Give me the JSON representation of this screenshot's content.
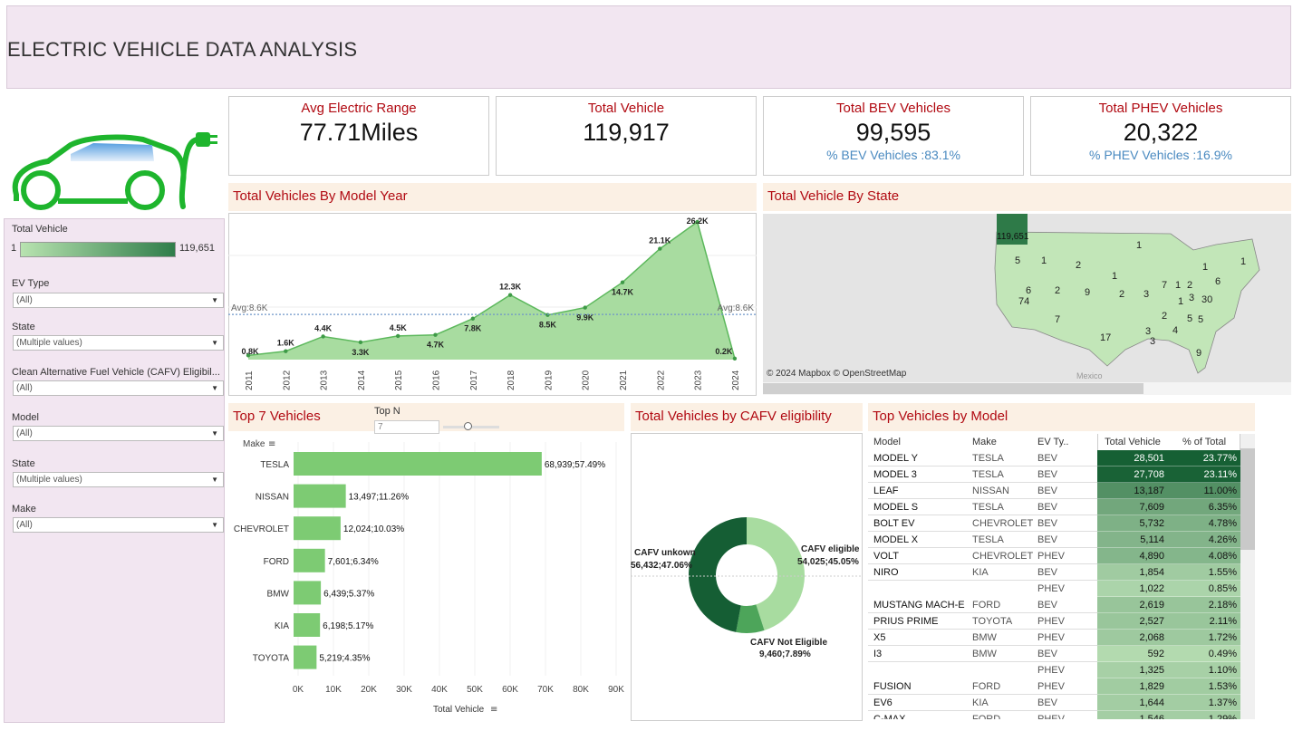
{
  "title": "ELECTRIC VEHICLE DATA ANALYSIS",
  "kpis": [
    {
      "label": "Avg Electric  Range",
      "value": "77.71Miles",
      "sub": ""
    },
    {
      "label": "Total Vehicle",
      "value": "119,917",
      "sub": ""
    },
    {
      "label": "Total BEV Vehicles",
      "value": "99,595",
      "sub": "% BEV Vehicles :83.1%"
    },
    {
      "label": "Total PHEV Vehicles",
      "value": "20,322",
      "sub": "% PHEV Vehicles :16.9%"
    }
  ],
  "filters": {
    "legend_title": "Total Vehicle",
    "legend_min": "1",
    "legend_max": "119,651",
    "items": [
      {
        "label": "EV Type",
        "value": "(All)"
      },
      {
        "label": "State",
        "value": "(Multiple values)"
      },
      {
        "label": "Clean Alternative Fuel Vehicle (CAFV) Eligibil...",
        "value": "(All)"
      },
      {
        "label": "Model",
        "value": "(All)"
      },
      {
        "label": "State",
        "value": "(Multiple values)"
      },
      {
        "label": "Make",
        "value": "(All)"
      }
    ]
  },
  "panels": {
    "model_year": "Total Vehicles By Model Year",
    "state": "Total Vehicle By State",
    "top7": "Top 7 Vehicles",
    "cafv": "Total Vehicles by CAFV eligibility",
    "top_model": "Top Vehicles by Model"
  },
  "top_n": {
    "label": "Top N",
    "value": "7"
  },
  "colors": {
    "accent_red": "#b10a12",
    "green_light": "#7dcb73",
    "green_dark": "#155e34",
    "panel_bg": "#fbf0e4",
    "filter_bg": "#f2e6f1"
  },
  "chart_data": [
    {
      "type": "area",
      "title": "Total Vehicles By Model Year",
      "x": [
        "2011",
        "2012",
        "2013",
        "2014",
        "2015",
        "2016",
        "2017",
        "2018",
        "2019",
        "2020",
        "2021",
        "2022",
        "2023",
        "2024"
      ],
      "values": [
        0.8,
        1.6,
        4.4,
        3.3,
        4.5,
        4.7,
        7.8,
        12.3,
        8.5,
        9.9,
        14.7,
        21.1,
        26.2,
        0.2
      ],
      "labels": [
        "0.8K",
        "1.6K",
        "4.4K",
        "3.3K",
        "4.5K",
        "4.7K",
        "7.8K",
        "12.3K",
        "8.5K",
        "9.9K",
        "14.7K",
        "21.1K",
        "26.2K",
        "0.2K"
      ],
      "average": 8.6,
      "average_label": "Avg:8.6K",
      "unit": "K"
    },
    {
      "type": "bar",
      "title": "Top 7 Vehicles",
      "ylabel": "Make",
      "xlabel": "Total Vehicle",
      "categories": [
        "TESLA",
        "NISSAN",
        "CHEVROLET",
        "FORD",
        "BMW",
        "KIA",
        "TOYOTA"
      ],
      "values": [
        68939,
        13497,
        12024,
        7601,
        6439,
        6198,
        5219
      ],
      "labels": [
        "68,939;57.49%",
        "13,497;11.26%",
        "12,024;10.03%",
        "7,601;6.34%",
        "6,439;5.37%",
        "6,198;5.17%",
        "5,219;4.35%"
      ],
      "xticks": [
        "0K",
        "10K",
        "20K",
        "30K",
        "40K",
        "50K",
        "60K",
        "70K",
        "80K",
        "90K"
      ],
      "xlim": [
        0,
        90000
      ]
    },
    {
      "type": "pie",
      "title": "Total Vehicles by CAFV eligibility",
      "slices": [
        {
          "name": "CAFV eligible",
          "value": 54025,
          "label": "54,025;45.05%"
        },
        {
          "name": "CAFV Not Eligible",
          "value": 9460,
          "label": "9,460;7.89%"
        },
        {
          "name": "CAFV unkown",
          "value": 56432,
          "label": "56,432;47.06%"
        }
      ]
    }
  ],
  "map": {
    "attribution": "© 2024 Mapbox  © OpenStreetMap",
    "country_label": "Mexico",
    "top_value": "119,651",
    "state_values": [
      "1",
      "5",
      "1",
      "2",
      "1",
      "6",
      "2",
      "9",
      "2",
      "3",
      "7",
      "1",
      "2",
      "74",
      "7",
      "1",
      "3",
      "30",
      "2",
      "1",
      "3",
      "4",
      "5",
      "17",
      "3",
      "9",
      "6",
      "1",
      "5"
    ]
  },
  "model_table": {
    "headers": [
      "Model",
      "Make",
      "EV Ty..",
      "Total Vehicle",
      "% of Total"
    ],
    "rows": [
      [
        "MODEL Y",
        "TESLA",
        "BEV",
        "28,501",
        "23.77%"
      ],
      [
        "MODEL 3",
        "TESLA",
        "BEV",
        "27,708",
        "23.11%"
      ],
      [
        "LEAF",
        "NISSAN",
        "BEV",
        "13,187",
        "11.00%"
      ],
      [
        "MODEL S",
        "TESLA",
        "BEV",
        "7,609",
        "6.35%"
      ],
      [
        "BOLT EV",
        "CHEVROLET",
        "BEV",
        "5,732",
        "4.78%"
      ],
      [
        "MODEL X",
        "TESLA",
        "BEV",
        "5,114",
        "4.26%"
      ],
      [
        "VOLT",
        "CHEVROLET",
        "PHEV",
        "4,890",
        "4.08%"
      ],
      [
        "NIRO",
        "KIA",
        "BEV",
        "1,854",
        "1.55%"
      ],
      [
        "",
        "",
        "PHEV",
        "1,022",
        "0.85%"
      ],
      [
        "MUSTANG MACH-E",
        "FORD",
        "BEV",
        "2,619",
        "2.18%"
      ],
      [
        "PRIUS PRIME",
        "TOYOTA",
        "PHEV",
        "2,527",
        "2.11%"
      ],
      [
        "X5",
        "BMW",
        "PHEV",
        "2,068",
        "1.72%"
      ],
      [
        "I3",
        "BMW",
        "BEV",
        "592",
        "0.49%"
      ],
      [
        "",
        "",
        "PHEV",
        "1,325",
        "1.10%"
      ],
      [
        "FUSION",
        "FORD",
        "PHEV",
        "1,829",
        "1.53%"
      ],
      [
        "EV6",
        "KIA",
        "BEV",
        "1,644",
        "1.37%"
      ],
      [
        "C-MAX",
        "FORD",
        "PHEV",
        "1,546",
        "1.29%"
      ]
    ]
  }
}
